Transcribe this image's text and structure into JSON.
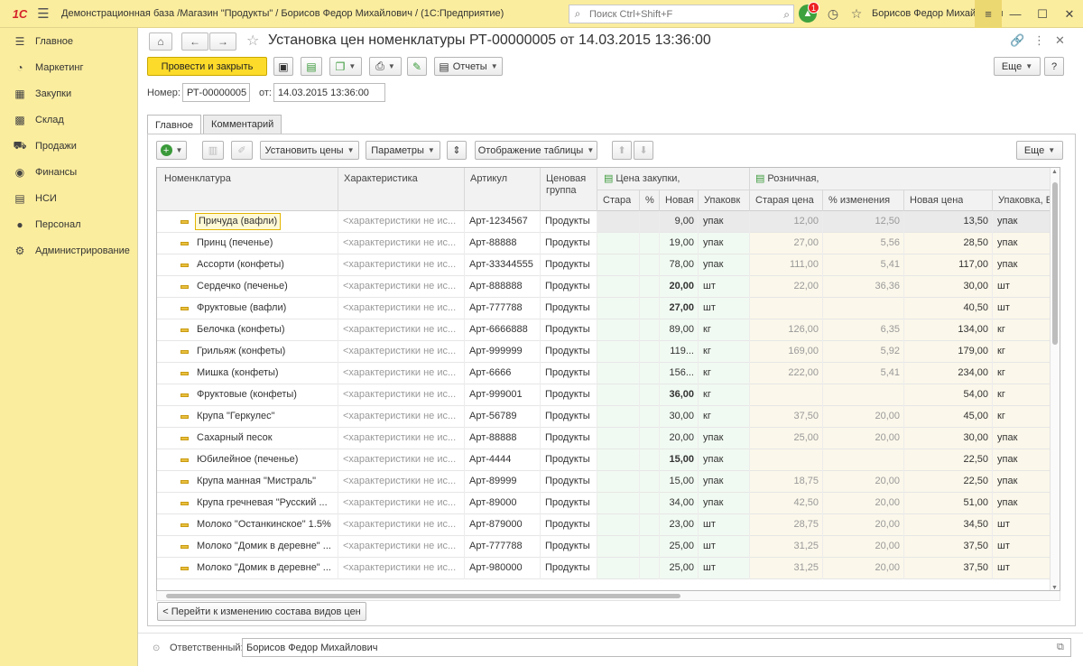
{
  "titlebar": {
    "logo": "1С",
    "title": "Демонстрационная база /Магазин \"Продукты\" / Борисов Федор Михайлович /  (1С:Предприятие)",
    "search_placeholder": "Поиск Ctrl+Shift+F",
    "notifications_count": "1",
    "user": "Борисов Федор Михайлович"
  },
  "sidebar": {
    "items": [
      {
        "label": "Главное",
        "icon": "menu-icon"
      },
      {
        "label": "Маркетинг",
        "icon": "marketing-icon"
      },
      {
        "label": "Закупки",
        "icon": "purchases-icon"
      },
      {
        "label": "Склад",
        "icon": "warehouse-icon"
      },
      {
        "label": "Продажи",
        "icon": "sales-icon"
      },
      {
        "label": "Финансы",
        "icon": "finance-icon"
      },
      {
        "label": "НСИ",
        "icon": "reference-icon"
      },
      {
        "label": "Персонал",
        "icon": "person-icon"
      },
      {
        "label": "Администрирование",
        "icon": "gear-icon"
      }
    ]
  },
  "document": {
    "title": "Установка цен номенклатуры РТ-00000005 от 14.03.2015 13:36:00",
    "post_close_label": "Провести и закрыть",
    "reports_label": "Отчеты",
    "more_label": "Еще",
    "number_label": "Номер:",
    "number_value": "РТ-00000005",
    "date_label": "от:",
    "date_value": "14.03.2015 13:36:00",
    "responsible_label": "Ответственный:",
    "responsible_value": "Борисов Федор Михайлович"
  },
  "tabs": [
    {
      "label": "Главное"
    },
    {
      "label": "Комментарий"
    }
  ],
  "table_toolbar": {
    "set_prices_label": "Установить цены",
    "params_label": "Параметры",
    "display_label": "Отображение таблицы",
    "more_label": "Еще"
  },
  "table": {
    "headers": {
      "nomenclature": "Номенклатура",
      "characteristic": "Характеристика",
      "article": "Артикул",
      "price_group": "Ценовая группа",
      "purchase_price": "Цена закупки,",
      "retail": "Розничная,",
      "old": "Стара",
      "percent": "%",
      "new": "Новая",
      "pack": "Упаковк",
      "old_price": "Старая цена",
      "change_percent": "% изменения",
      "new_price": "Новая цена",
      "pack_retail": "Упаковка, Е"
    },
    "rows": [
      {
        "name": "Причуда (вафли)",
        "char": "<характеристики не ис...",
        "art": "Арт-1234567",
        "group": "Продукты",
        "new": "9,00",
        "pack": "упак",
        "oldp": "12,00",
        "chg": "12,50",
        "newp": "13,50",
        "pack2": "упак",
        "bold": false
      },
      {
        "name": "Принц (печенье)",
        "char": "<характеристики не ис...",
        "art": "Арт-88888",
        "group": "Продукты",
        "new": "19,00",
        "pack": "упак",
        "oldp": "27,00",
        "chg": "5,56",
        "newp": "28,50",
        "pack2": "упак",
        "bold": false
      },
      {
        "name": "Ассорти (конфеты)",
        "char": "<характеристики не ис...",
        "art": "Арт-33344555",
        "group": "Продукты",
        "new": "78,00",
        "pack": "упак",
        "oldp": "111,00",
        "chg": "5,41",
        "newp": "117,00",
        "pack2": "упак",
        "bold": false
      },
      {
        "name": "Сердечко (печенье)",
        "char": "<характеристики не ис...",
        "art": "Арт-888888",
        "group": "Продукты",
        "new": "20,00",
        "pack": "шт",
        "oldp": "22,00",
        "chg": "36,36",
        "newp": "30,00",
        "pack2": "шт",
        "bold": true
      },
      {
        "name": "Фруктовые (вафли)",
        "char": "<характеристики не ис...",
        "art": "Арт-777788",
        "group": "Продукты",
        "new": "27,00",
        "pack": "шт",
        "oldp": "",
        "chg": "",
        "newp": "40,50",
        "pack2": "шт",
        "bold": true
      },
      {
        "name": "Белочка (конфеты)",
        "char": "<характеристики не ис...",
        "art": "Арт-6666888",
        "group": "Продукты",
        "new": "89,00",
        "pack": "кг",
        "oldp": "126,00",
        "chg": "6,35",
        "newp": "134,00",
        "pack2": "кг",
        "bold": false
      },
      {
        "name": "Грильяж (конфеты)",
        "char": "<характеристики не ис...",
        "art": "Арт-999999",
        "group": "Продукты",
        "new": "119...",
        "pack": "кг",
        "oldp": "169,00",
        "chg": "5,92",
        "newp": "179,00",
        "pack2": "кг",
        "bold": false
      },
      {
        "name": "Мишка (конфеты)",
        "char": "<характеристики не ис...",
        "art": "Арт-6666",
        "group": "Продукты",
        "new": "156...",
        "pack": "кг",
        "oldp": "222,00",
        "chg": "5,41",
        "newp": "234,00",
        "pack2": "кг",
        "bold": false
      },
      {
        "name": "Фруктовые (конфеты)",
        "char": "<характеристики не ис...",
        "art": "Арт-999001",
        "group": "Продукты",
        "new": "36,00",
        "pack": "кг",
        "oldp": "",
        "chg": "",
        "newp": "54,00",
        "pack2": "кг",
        "bold": true
      },
      {
        "name": "Крупа \"Геркулес\"",
        "char": "<характеристики не ис...",
        "art": "Арт-56789",
        "group": "Продукты",
        "new": "30,00",
        "pack": "кг",
        "oldp": "37,50",
        "chg": "20,00",
        "newp": "45,00",
        "pack2": "кг",
        "bold": false
      },
      {
        "name": "Сахарный песок",
        "char": "<характеристики не ис...",
        "art": "Арт-88888",
        "group": "Продукты",
        "new": "20,00",
        "pack": "упак",
        "oldp": "25,00",
        "chg": "20,00",
        "newp": "30,00",
        "pack2": "упак",
        "bold": false
      },
      {
        "name": "Юбилейное (печенье)",
        "char": "<характеристики не ис...",
        "art": "Арт-4444",
        "group": "Продукты",
        "new": "15,00",
        "pack": "упак",
        "oldp": "",
        "chg": "",
        "newp": "22,50",
        "pack2": "упак",
        "bold": true
      },
      {
        "name": "Крупа манная \"Мистраль\"",
        "char": "<характеристики не ис...",
        "art": "Арт-89999",
        "group": "Продукты",
        "new": "15,00",
        "pack": "упак",
        "oldp": "18,75",
        "chg": "20,00",
        "newp": "22,50",
        "pack2": "упак",
        "bold": false
      },
      {
        "name": "Крупа гречневая \"Русский ...",
        "char": "<характеристики не ис...",
        "art": "Арт-89000",
        "group": "Продукты",
        "new": "34,00",
        "pack": "упак",
        "oldp": "42,50",
        "chg": "20,00",
        "newp": "51,00",
        "pack2": "упак",
        "bold": false
      },
      {
        "name": "Молоко \"Останкинское\" 1.5%",
        "char": "<характеристики не ис...",
        "art": "Арт-879000",
        "group": "Продукты",
        "new": "23,00",
        "pack": "шт",
        "oldp": "28,75",
        "chg": "20,00",
        "newp": "34,50",
        "pack2": "шт",
        "bold": false
      },
      {
        "name": "Молоко \"Домик в деревне\" ...",
        "char": "<характеристики не ис...",
        "art": "Арт-777788",
        "group": "Продукты",
        "new": "25,00",
        "pack": "шт",
        "oldp": "31,25",
        "chg": "20,00",
        "newp": "37,50",
        "pack2": "шт",
        "bold": false
      },
      {
        "name": "Молоко \"Домик в деревне\" ...",
        "char": "<характеристики не ис...",
        "art": "Арт-980000",
        "group": "Продукты",
        "new": "25,00",
        "pack": "шт",
        "oldp": "31,25",
        "chg": "20,00",
        "newp": "37,50",
        "pack2": "шт",
        "bold": false
      }
    ]
  },
  "bottom": {
    "goto_label": "< Перейти к изменению состава видов цен"
  }
}
